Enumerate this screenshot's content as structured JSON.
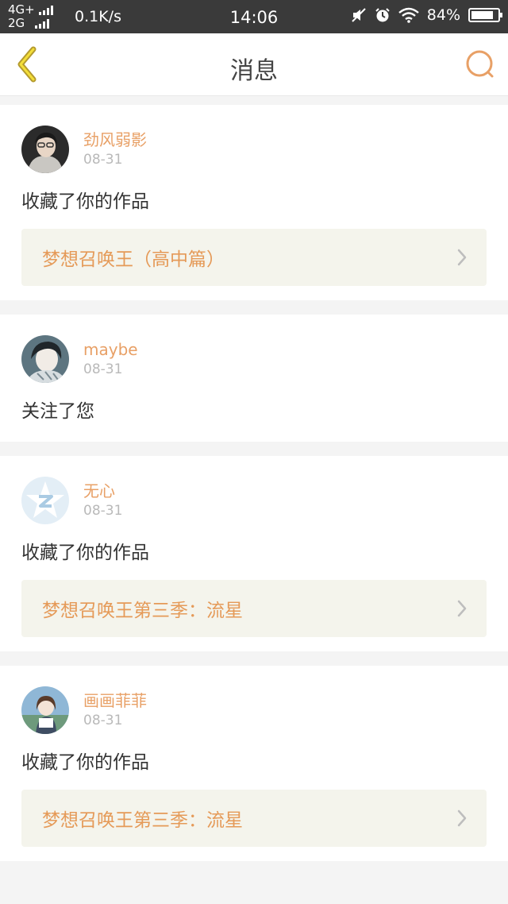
{
  "status_bar": {
    "network_top": "4G+",
    "network_bottom": "2G",
    "speed": "0.1K/s",
    "time": "14:06",
    "battery": "84%",
    "battery_level": 0.84,
    "icons": [
      "signal-icon",
      "mute-icon",
      "alarm-icon",
      "wifi-icon",
      "battery-icon"
    ]
  },
  "header": {
    "title": "消息",
    "back_icon": "chevron-left-icon",
    "search_icon": "search-icon",
    "accent_color": "#e8a066"
  },
  "messages": [
    {
      "user": "劲风弱影",
      "date": "08-31",
      "action": "收藏了你的作品",
      "work": "梦想召唤王（高中篇）"
    },
    {
      "user": "maybe",
      "date": "08-31",
      "action": "关注了您"
    },
    {
      "user": "无心",
      "date": "08-31",
      "action": "收藏了你的作品",
      "work": "梦想召唤王第三季：流星"
    },
    {
      "user": "画画菲菲",
      "date": "08-31",
      "action": "收藏了你的作品",
      "work": "梦想召唤王第三季：流星"
    }
  ]
}
